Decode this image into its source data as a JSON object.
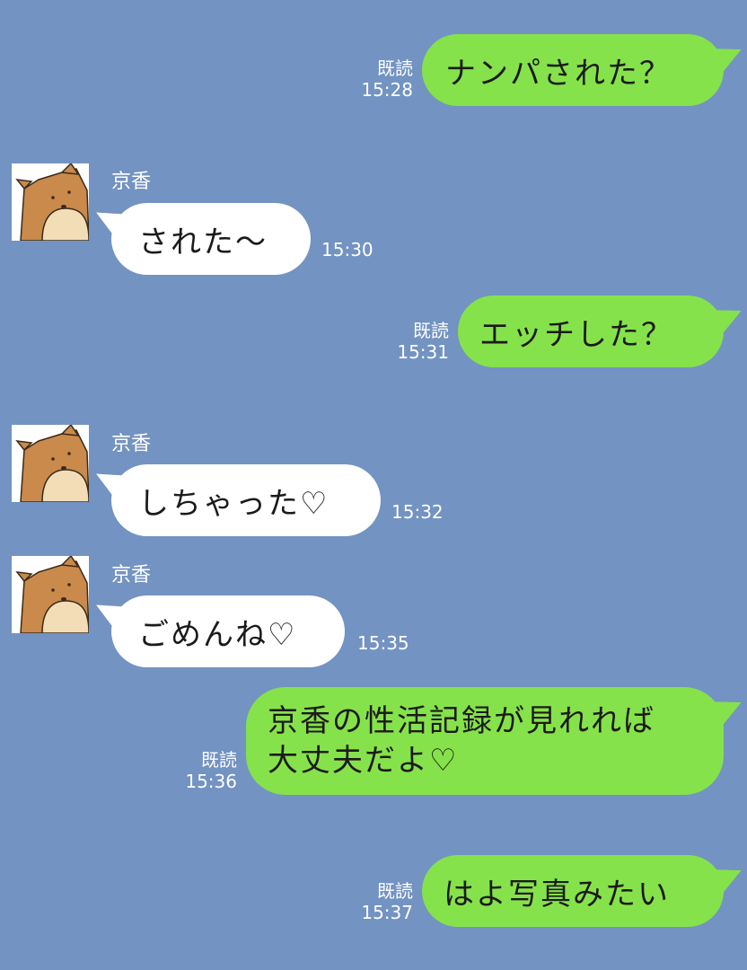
{
  "colors": {
    "background": "#7393c2",
    "outgoing_bubble": "#86e24a",
    "incoming_bubble": "#ffffff",
    "meta_text": "#ffffff"
  },
  "messages": [
    {
      "direction": "outgoing",
      "text": "ナンパされた？",
      "read": "既読",
      "time": "15:28"
    },
    {
      "direction": "incoming",
      "sender": "京香",
      "avatar": "shiba-dog-avatar",
      "text": "された〜",
      "time": "15:30"
    },
    {
      "direction": "outgoing",
      "text": "エッチした？",
      "read": "既読",
      "time": "15:31"
    },
    {
      "direction": "incoming",
      "sender": "京香",
      "avatar": "shiba-dog-avatar",
      "text": "しちゃった♡",
      "time": "15:32"
    },
    {
      "direction": "incoming",
      "sender": "京香",
      "avatar": "shiba-dog-avatar",
      "text": "ごめんね♡",
      "time": "15:35"
    },
    {
      "direction": "outgoing",
      "text": "京香の性活記録が見れれば\n大丈夫だよ♡",
      "read": "既読",
      "time": "15:36"
    },
    {
      "direction": "outgoing",
      "text": "はよ写真みたい",
      "read": "既読",
      "time": "15:37"
    }
  ]
}
